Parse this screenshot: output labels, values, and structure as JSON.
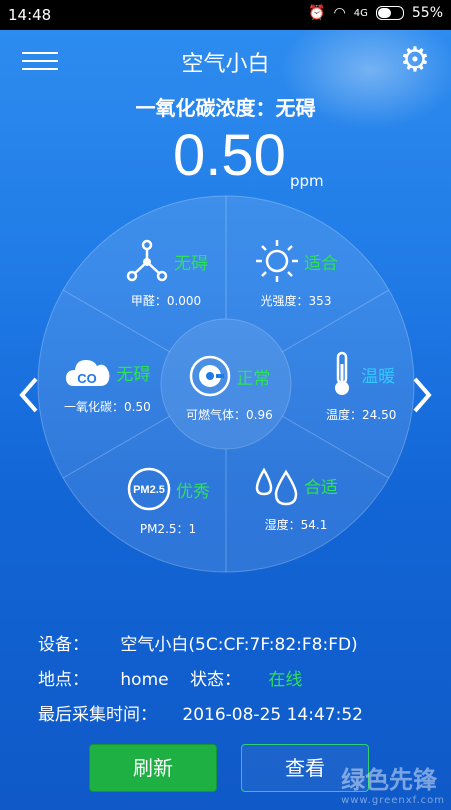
{
  "statusbar": {
    "time": "14:48",
    "battery": "55%",
    "network": "4G"
  },
  "header": {
    "title": "空气小白"
  },
  "main": {
    "headline": "一氧化碳浓度：无碍",
    "value": "0.50",
    "unit": "ppm"
  },
  "colors": {
    "good": "#2ee05a",
    "warm": "#35c8ff",
    "bg": "#1f7ae6"
  },
  "sensors": {
    "formaldehyde": {
      "status": "无碍",
      "label": "甲醛：0.000",
      "icon": "molecule-icon"
    },
    "light": {
      "status": "适合",
      "label": "光强度：353",
      "icon": "sun-icon"
    },
    "co": {
      "status": "无碍",
      "label": "一氧化碳：0.50",
      "icon": "co-cloud-icon"
    },
    "gas": {
      "status": "正常",
      "label": "可燃气体：0.96",
      "icon": "gas-tank-icon"
    },
    "temp": {
      "status": "温暖",
      "label": "温度：24.50",
      "icon": "thermometer-icon"
    },
    "pm25": {
      "status": "优秀",
      "label": "PM2.5：1",
      "icon": "pm25-icon",
      "icon_text": "PM2.5"
    },
    "humidity": {
      "status": "合适",
      "label": "湿度：54.1",
      "icon": "water-drops-icon"
    }
  },
  "info": {
    "device_label": "设备：",
    "device_value": "空气小白(5C:CF:7F:82:F8:FD)",
    "location_label": "地点：",
    "location_value": "home",
    "state_label": "状态：",
    "state_value": "在线",
    "time_label": "最后采集时间：",
    "time_value": "2016-08-25 14:47:52"
  },
  "buttons": {
    "refresh": "刷新",
    "view": "查看"
  },
  "watermark": {
    "text": "绿色先锋",
    "url": "www.greenxf.com"
  }
}
